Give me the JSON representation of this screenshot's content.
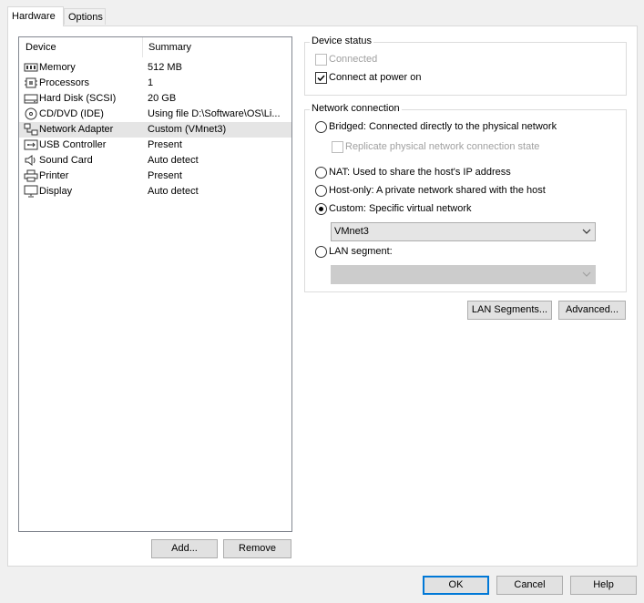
{
  "tabs": [
    {
      "label": "Hardware"
    },
    {
      "label": "Options"
    }
  ],
  "device_list": {
    "columns": {
      "device": "Device",
      "summary": "Summary"
    },
    "rows": [
      {
        "name": "Memory",
        "summary": "512 MB",
        "icon": "memory-icon"
      },
      {
        "name": "Processors",
        "summary": "1",
        "icon": "processor-icon"
      },
      {
        "name": "Hard Disk (SCSI)",
        "summary": "20 GB",
        "icon": "hard-disk-icon"
      },
      {
        "name": "CD/DVD (IDE)",
        "summary": "Using file D:\\Software\\OS\\Li...",
        "icon": "cd-dvd-icon"
      },
      {
        "name": "Network Adapter",
        "summary": "Custom (VMnet3)",
        "icon": "network-adapter-icon"
      },
      {
        "name": "USB Controller",
        "summary": "Present",
        "icon": "usb-icon"
      },
      {
        "name": "Sound Card",
        "summary": "Auto detect",
        "icon": "speaker-icon"
      },
      {
        "name": "Printer",
        "summary": "Present",
        "icon": "printer-icon"
      },
      {
        "name": "Display",
        "summary": "Auto detect",
        "icon": "monitor-icon"
      }
    ],
    "selected_index": 4
  },
  "list_buttons": {
    "add": "Add...",
    "remove": "Remove"
  },
  "device_status": {
    "title": "Device status",
    "connected": {
      "label": "Connected",
      "checked": false,
      "enabled": false
    },
    "connect_at_power_on": {
      "label": "Connect at power on",
      "checked": true,
      "enabled": true
    }
  },
  "network_connection": {
    "title": "Network connection",
    "bridged": {
      "label": "Bridged: Connected directly to the physical network"
    },
    "replicate": {
      "label": "Replicate physical network connection state",
      "checked": false,
      "enabled": false
    },
    "nat": {
      "label": "NAT: Used to share the host's IP address"
    },
    "host_only": {
      "label": "Host-only: A private network shared with the host"
    },
    "custom": {
      "label": "Custom: Specific virtual network",
      "selected": true
    },
    "custom_network": "VMnet3",
    "lan_segment": {
      "label": "LAN segment:"
    },
    "lan_segment_value": ""
  },
  "side_buttons": {
    "lan_segments": "LAN Segments...",
    "advanced": "Advanced..."
  },
  "dialog_buttons": {
    "ok": "OK",
    "cancel": "Cancel",
    "help": "Help"
  }
}
